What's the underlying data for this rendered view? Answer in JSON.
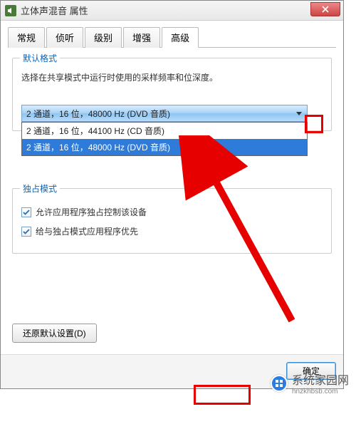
{
  "window": {
    "title": "立体声混音 属性"
  },
  "tabs": [
    "常规",
    "侦听",
    "级别",
    "增强",
    "高级"
  ],
  "active_tab": 4,
  "group_default": {
    "title": "默认格式",
    "desc": "选择在共享模式中运行时使用的采样频率和位深度。",
    "combo_value": "2 通道，16 位，48000 Hz (DVD 音质)",
    "options": [
      "2 通道，16 位，44100 Hz (CD 音质)",
      "2 通道，16 位，48000 Hz (DVD 音质)"
    ],
    "selected_option": 1
  },
  "group_exclusive": {
    "title": "独占模式",
    "chk1": {
      "checked": true,
      "label": "允许应用程序独占控制该设备"
    },
    "chk2": {
      "checked": true,
      "label": "给与独占模式应用程序优先"
    }
  },
  "restore_label": "还原默认设置(D)",
  "footer": {
    "ok": "确定"
  },
  "watermark": {
    "text": "系统家园网",
    "url": "hnzkhbsb.com"
  }
}
